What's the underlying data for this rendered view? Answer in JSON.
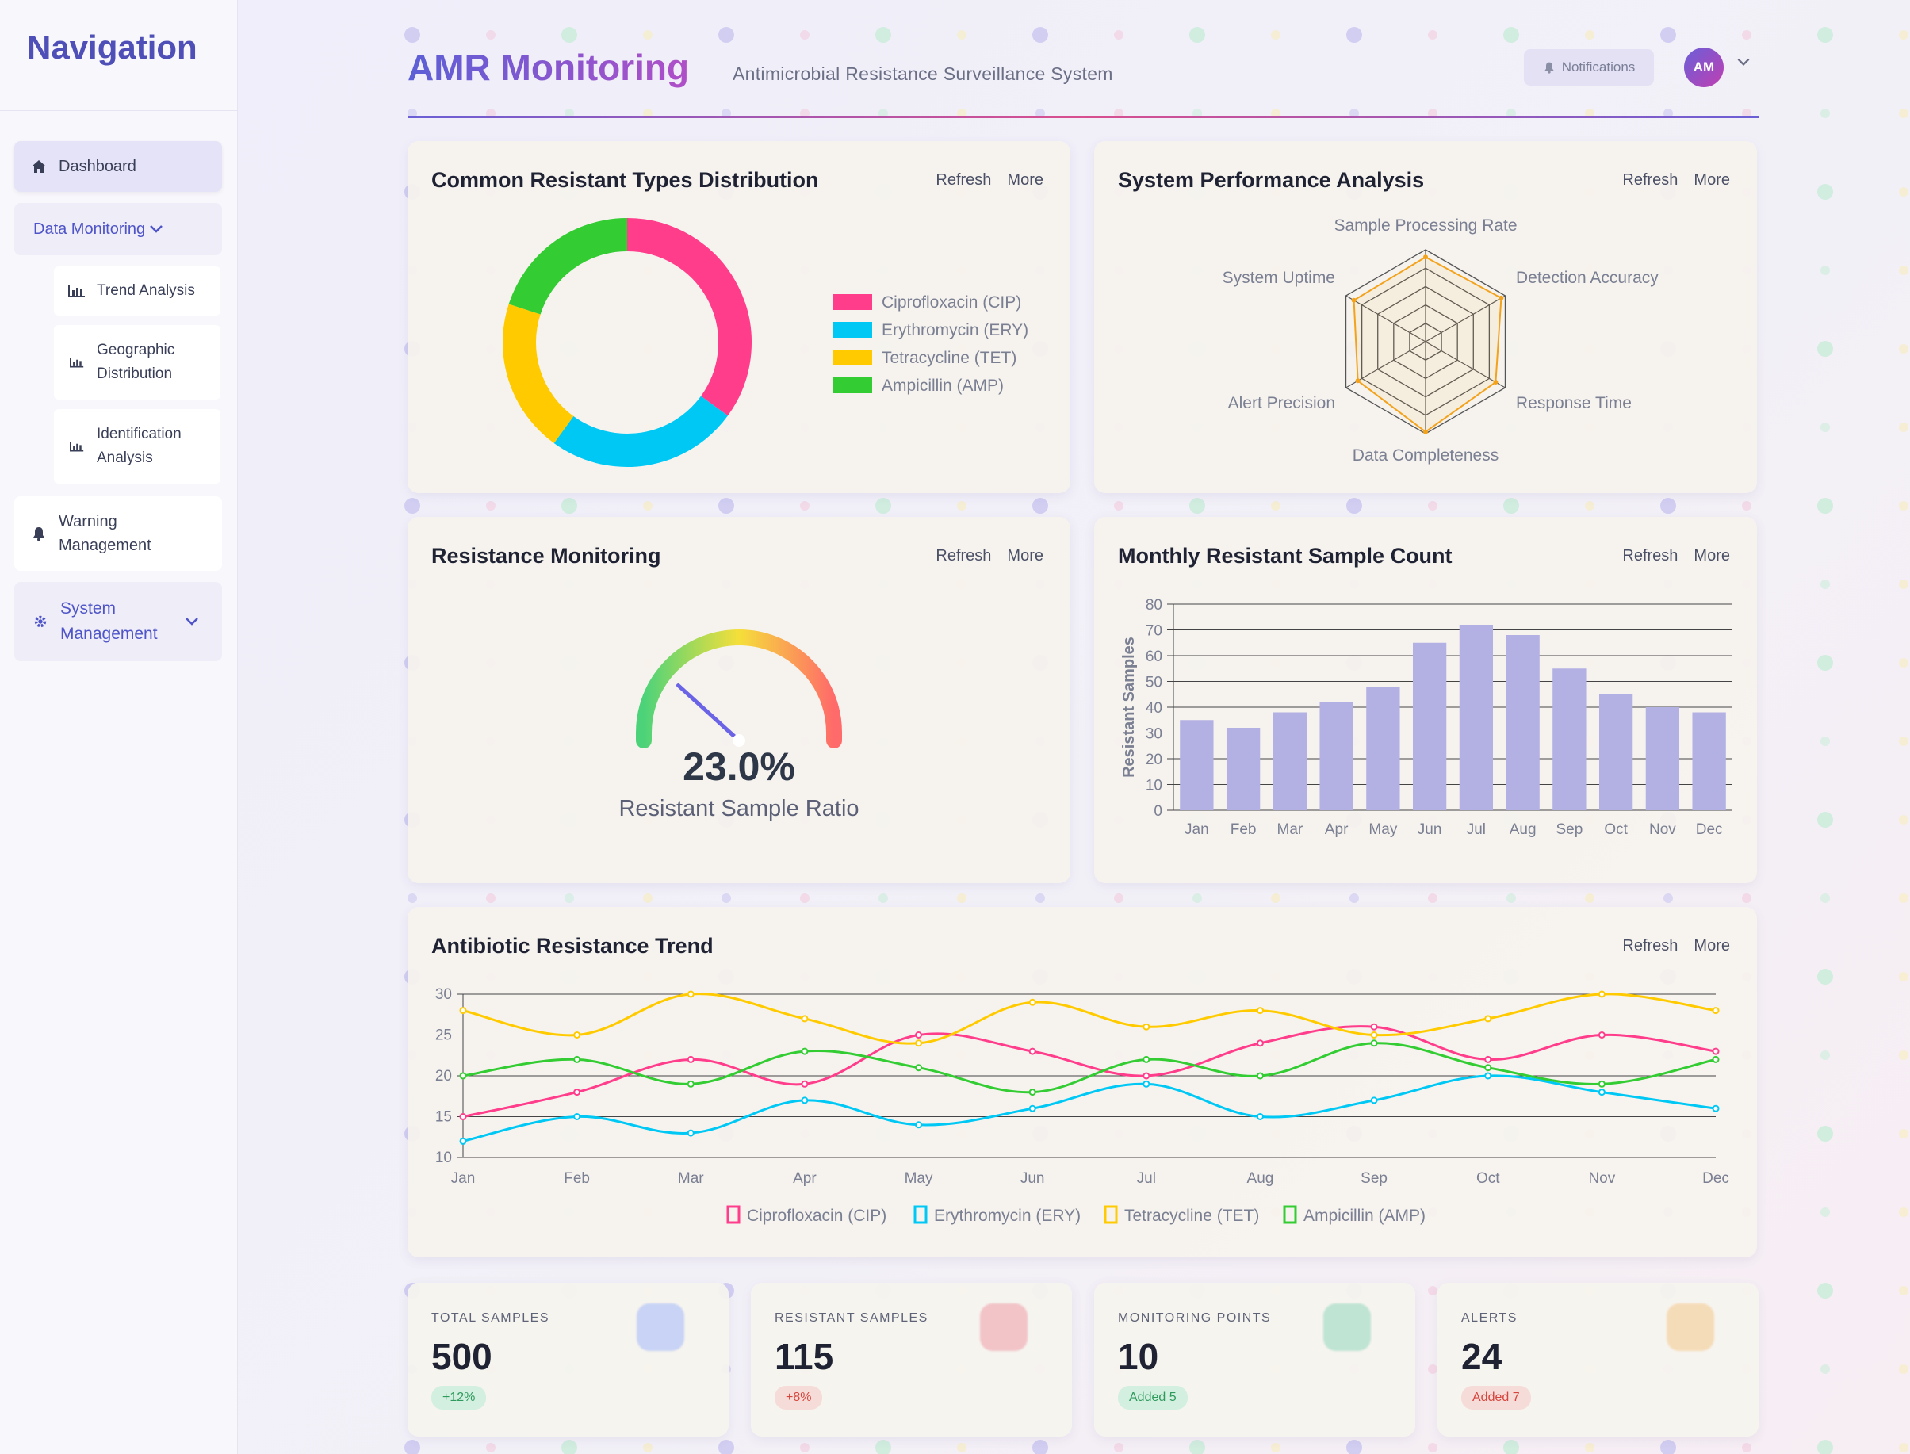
{
  "sidebar": {
    "title": "Navigation",
    "items": [
      {
        "label": "Dashboard",
        "icon": "home-icon"
      },
      {
        "label": "Data Monitoring",
        "icon": "chevron-down-icon"
      },
      {
        "label": "Trend Analysis",
        "icon": "bar-chart-icon"
      },
      {
        "label": "Geographic Distribution",
        "icon": "bar-chart-icon"
      },
      {
        "label": "Identification Analysis",
        "icon": "bar-chart-icon"
      },
      {
        "label": "Warning Management",
        "icon": "bell-icon"
      },
      {
        "label": "System Management",
        "icon": "gear-icon"
      }
    ]
  },
  "header": {
    "title": "AMR Monitoring",
    "subtitle": "Antimicrobial Resistance Surveillance System",
    "notifications_label": "Notifications",
    "avatar_initials": "AM"
  },
  "card_actions": {
    "refresh": "Refresh",
    "more": "More"
  },
  "cards": {
    "distribution": "Common Resistant Types Distribution",
    "performance": "System Performance Analysis",
    "monitoring": "Resistance Monitoring",
    "monthly": "Monthly Resistant Sample Count",
    "trend": "Antibiotic Resistance Trend"
  },
  "gauge": {
    "value_label": "23.0%",
    "caption": "Resistant Sample Ratio",
    "ratio": 0.23
  },
  "colors": {
    "cip": "#ff3d8b",
    "ery": "#00c8f5",
    "tet": "#ffcb00",
    "amp": "#33cc33",
    "bar": "#b3b0e3",
    "radar": "#f3a21c"
  },
  "chart_data": [
    {
      "type": "pie",
      "title": "Common Resistant Types Distribution",
      "categories": [
        "Ciprofloxacin (CIP)",
        "Erythromycin (ERY)",
        "Tetracycline (TET)",
        "Ampicillin (AMP)"
      ],
      "values": [
        35,
        25,
        20,
        20
      ],
      "legend": "right"
    },
    {
      "type": "radar",
      "title": "System Performance Analysis",
      "categories": [
        "Sample Processing Rate",
        "Detection Accuracy",
        "Response Time",
        "Data Completeness",
        "Alert Precision",
        "System Uptime"
      ],
      "values": [
        92,
        95,
        88,
        98,
        85,
        90
      ],
      "rlim": [
        0,
        100
      ]
    },
    {
      "type": "bar",
      "title": "Monthly Resistant Sample Count",
      "categories": [
        "Jan",
        "Feb",
        "Mar",
        "Apr",
        "May",
        "Jun",
        "Jul",
        "Aug",
        "Sep",
        "Oct",
        "Nov",
        "Dec"
      ],
      "values": [
        35,
        32,
        38,
        42,
        48,
        65,
        72,
        68,
        55,
        45,
        40,
        38
      ],
      "ylabel": "Resistant Samples",
      "ylim": [
        0,
        80
      ],
      "yticks": [
        0,
        10,
        20,
        30,
        40,
        50,
        60,
        70,
        80
      ]
    },
    {
      "type": "line",
      "title": "Antibiotic Resistance Trend",
      "categories": [
        "Jan",
        "Feb",
        "Mar",
        "Apr",
        "May",
        "Jun",
        "Jul",
        "Aug",
        "Sep",
        "Oct",
        "Nov",
        "Dec"
      ],
      "series": [
        {
          "name": "Ciprofloxacin (CIP)",
          "values": [
            15,
            18,
            22,
            19,
            25,
            23,
            20,
            24,
            26,
            22,
            25,
            23
          ]
        },
        {
          "name": "Erythromycin (ERY)",
          "values": [
            12,
            15,
            13,
            17,
            14,
            16,
            19,
            15,
            17,
            20,
            18,
            16
          ]
        },
        {
          "name": "Tetracycline (TET)",
          "values": [
            28,
            25,
            30,
            27,
            24,
            29,
            26,
            28,
            25,
            27,
            30,
            28
          ]
        },
        {
          "name": "Ampicillin (AMP)",
          "values": [
            20,
            22,
            19,
            23,
            21,
            18,
            22,
            20,
            24,
            21,
            19,
            22
          ]
        }
      ],
      "ylim": [
        10,
        30
      ],
      "yticks": [
        10,
        15,
        20,
        25,
        30
      ],
      "legend": "bottom"
    }
  ],
  "stats": [
    {
      "label": "TOTAL SAMPLES",
      "value": "500",
      "badge": "+12%",
      "tone": "green",
      "tile": "#c8d3f5"
    },
    {
      "label": "RESISTANT SAMPLES",
      "value": "115",
      "badge": "+8%",
      "tone": "red",
      "tile": "#f2c4c8"
    },
    {
      "label": "MONITORING POINTS",
      "value": "10",
      "badge": "Added 5",
      "tone": "green",
      "tile": "#bfe4d4"
    },
    {
      "label": "ALERTS",
      "value": "24",
      "badge": "Added 7",
      "tone": "red",
      "tile": "#f5dcb8"
    }
  ]
}
